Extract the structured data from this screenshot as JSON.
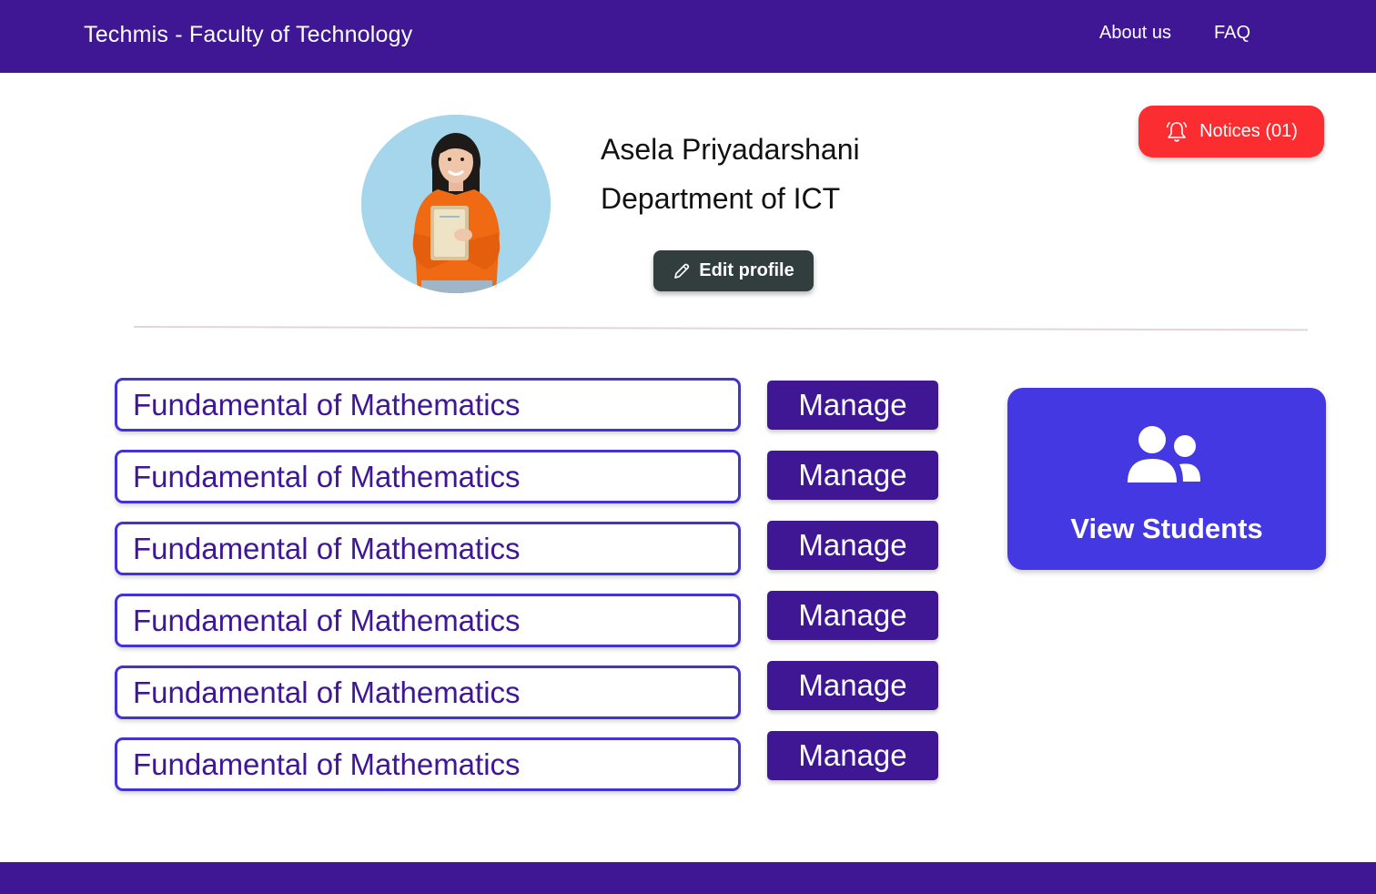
{
  "header": {
    "brand": "Techmis - Faculty of Technology",
    "nav": [
      {
        "label": "About us"
      },
      {
        "label": "FAQ"
      }
    ]
  },
  "profile": {
    "name": "Asela Priyadarshani",
    "department": "Department of ICT",
    "edit_label": "Edit profile",
    "avatar_icon": "student-photo"
  },
  "notices": {
    "label": "Notices (01)",
    "icon": "bell-icon",
    "color": "#fb2d31"
  },
  "courses": [
    {
      "name": "Fundamental of Mathematics",
      "action": "Manage"
    },
    {
      "name": "Fundamental of Mathematics",
      "action": "Manage"
    },
    {
      "name": "Fundamental of Mathematics",
      "action": "Manage"
    },
    {
      "name": "Fundamental of Mathematics",
      "action": "Manage"
    },
    {
      "name": "Fundamental of Mathematics",
      "action": "Manage"
    },
    {
      "name": "Fundamental of Mathematics",
      "action": "Manage"
    }
  ],
  "view_students": {
    "label": "View Students",
    "icon": "users-icon",
    "color": "#4338e2"
  },
  "theme": {
    "primary": "#3f1694",
    "accent": "#4233d6"
  }
}
